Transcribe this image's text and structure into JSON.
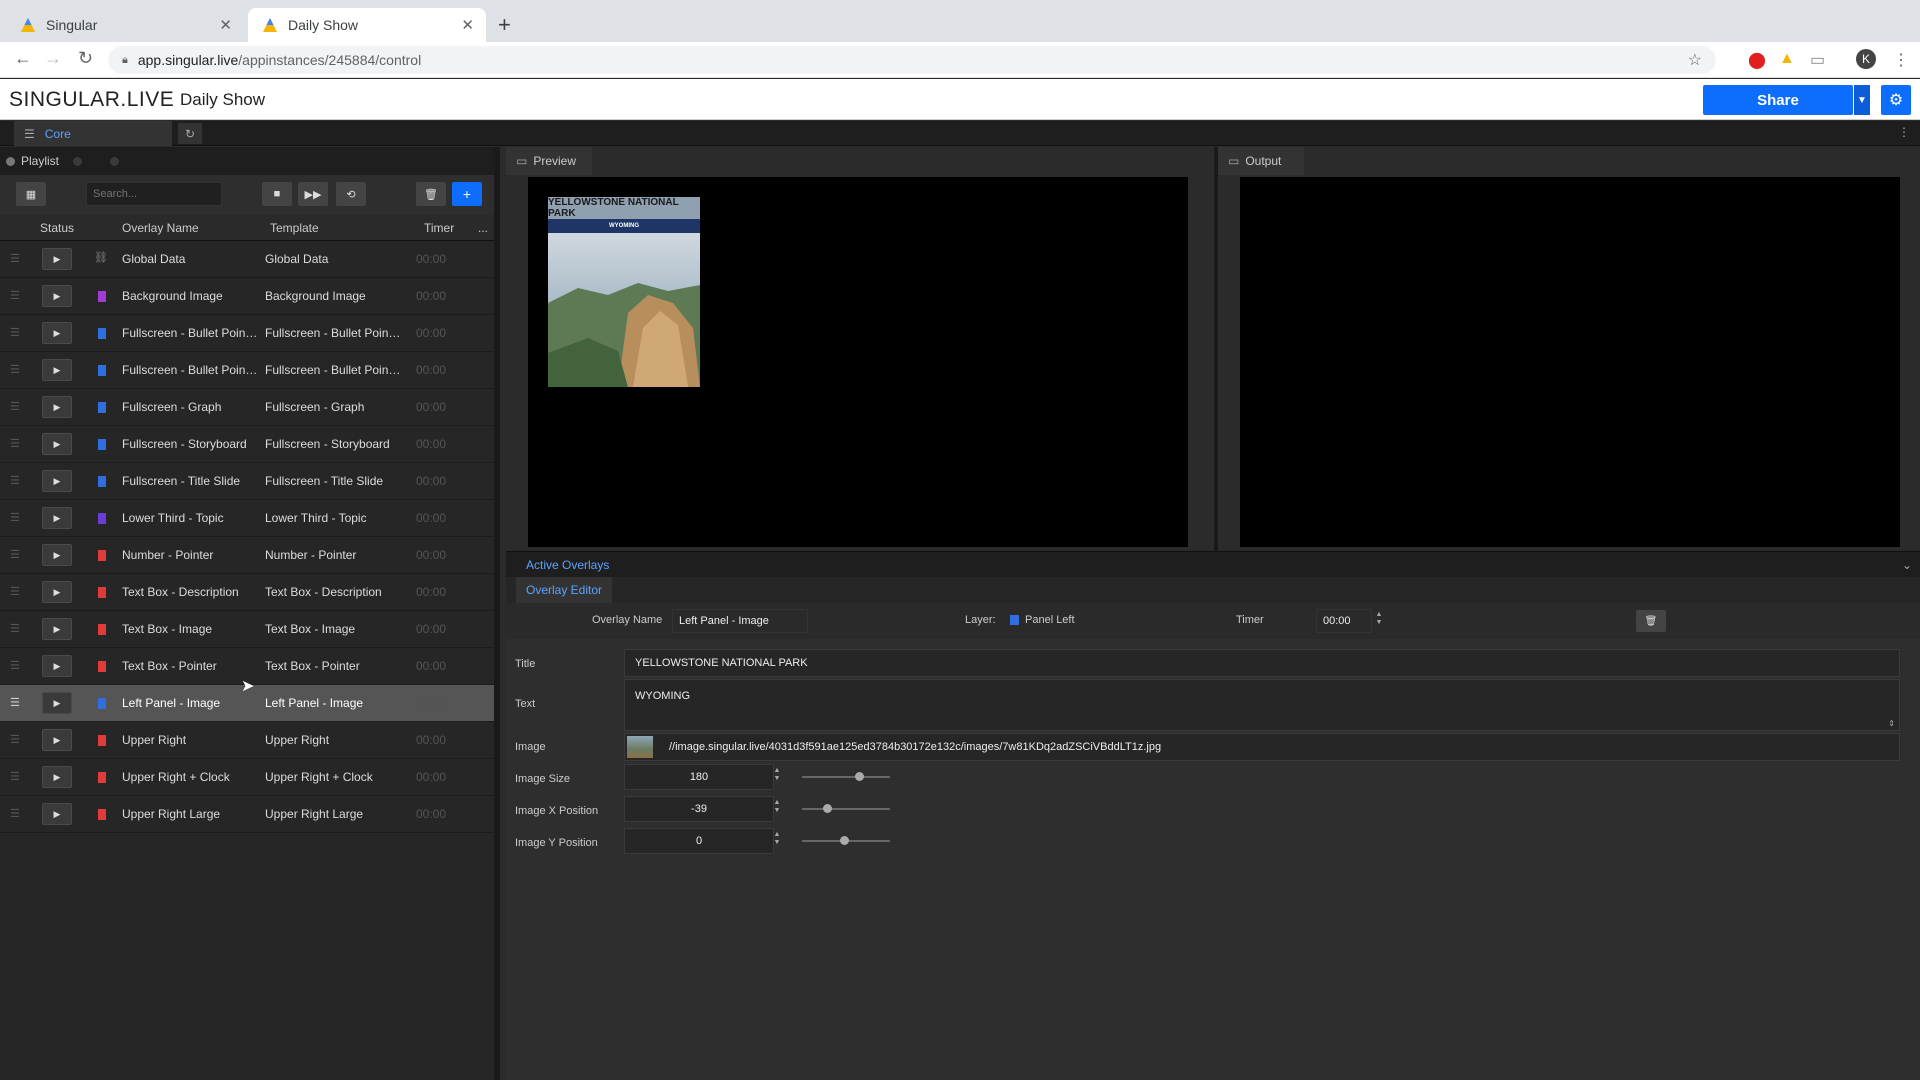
{
  "browser": {
    "tabs": [
      {
        "title": "Singular"
      },
      {
        "title": "Daily Show"
      }
    ],
    "url_host": "app.singular.live",
    "url_path": "/appinstances/245884/control",
    "profile_initial": "K"
  },
  "app": {
    "logo": "SINGULAR.LIVE",
    "show_title": "Daily Show",
    "share_label": "Share",
    "core_tab": "Core"
  },
  "playlist": {
    "tab_label": "Playlist",
    "search_placeholder": "Search...",
    "columns": [
      "Status",
      "Overlay Name",
      "Template",
      "Timer",
      "..."
    ],
    "rows": [
      {
        "overlay": "Global Data",
        "template": "Global Data",
        "timer": "00:00",
        "color": "#888888"
      },
      {
        "overlay": "Background Image",
        "template": "Background Image",
        "timer": "00:00",
        "color": "#a13bd6"
      },
      {
        "overlay": "Fullscreen - Bullet Point...",
        "template": "Fullscreen - Bullet Point...",
        "timer": "00:00",
        "color": "#2f6de0"
      },
      {
        "overlay": "Fullscreen - Bullet Point...",
        "template": "Fullscreen - Bullet Point...",
        "timer": "00:00",
        "color": "#2f6de0"
      },
      {
        "overlay": "Fullscreen - Graph",
        "template": "Fullscreen - Graph",
        "timer": "00:00",
        "color": "#2f6de0"
      },
      {
        "overlay": "Fullscreen - Storyboard",
        "template": "Fullscreen - Storyboard",
        "timer": "00:00",
        "color": "#2f6de0"
      },
      {
        "overlay": "Fullscreen - Title Slide",
        "template": "Fullscreen - Title Slide",
        "timer": "00:00",
        "color": "#2f6de0"
      },
      {
        "overlay": "Lower Third - Topic",
        "template": "Lower Third - Topic",
        "timer": "00:00",
        "color": "#6a3ed6"
      },
      {
        "overlay": "Number - Pointer",
        "template": "Number - Pointer",
        "timer": "00:00",
        "color": "#e03a3a"
      },
      {
        "overlay": "Text Box - Description",
        "template": "Text Box - Description",
        "timer": "00:00",
        "color": "#e03a3a"
      },
      {
        "overlay": "Text Box - Image",
        "template": "Text Box - Image",
        "timer": "00:00",
        "color": "#e03a3a"
      },
      {
        "overlay": "Text Box - Pointer",
        "template": "Text Box - Pointer",
        "timer": "00:00",
        "color": "#e03a3a"
      },
      {
        "overlay": "Left Panel - Image",
        "template": "Left Panel - Image",
        "timer": "00:00",
        "color": "#2f6de0",
        "selected": true
      },
      {
        "overlay": "Upper Right",
        "template": "Upper Right",
        "timer": "00:00",
        "color": "#e03a3a"
      },
      {
        "overlay": "Upper Right + Clock",
        "template": "Upper Right + Clock",
        "timer": "00:00",
        "color": "#e03a3a"
      },
      {
        "overlay": "Upper Right Large",
        "template": "Upper Right Large",
        "timer": "00:00",
        "color": "#e03a3a"
      }
    ]
  },
  "preview": {
    "label": "Preview",
    "card_title": "YELLOWSTONE NATIONAL PARK",
    "card_subtitle": "WYOMING"
  },
  "output": {
    "label": "Output"
  },
  "active_overlays_label": "Active Overlays",
  "editor": {
    "tab_label": "Overlay Editor",
    "overlay_name_label": "Overlay Name",
    "overlay_name_value": "Left Panel - Image",
    "layer_label": "Layer:",
    "layer_value": "Panel Left",
    "timer_label": "Timer",
    "timer_value": "00:00",
    "fields": {
      "title_label": "Title",
      "title_value": "YELLOWSTONE NATIONAL PARK",
      "text_label": "Text",
      "text_value": "WYOMING",
      "image_label": "Image",
      "image_value": "//image.singular.live/4031d3f591ae125ed3784b30172e132c/images/7w81KDq2adZSCiVBddLT1z.jpg",
      "image_size_label": "Image Size",
      "image_size_value": "180",
      "image_x_label": "Image X Position",
      "image_x_value": "-39",
      "image_y_label": "Image Y Position",
      "image_y_value": "0"
    },
    "slider_levels": {
      "image_size": 0.65,
      "image_x": 0.28,
      "image_y": 0.48
    }
  }
}
